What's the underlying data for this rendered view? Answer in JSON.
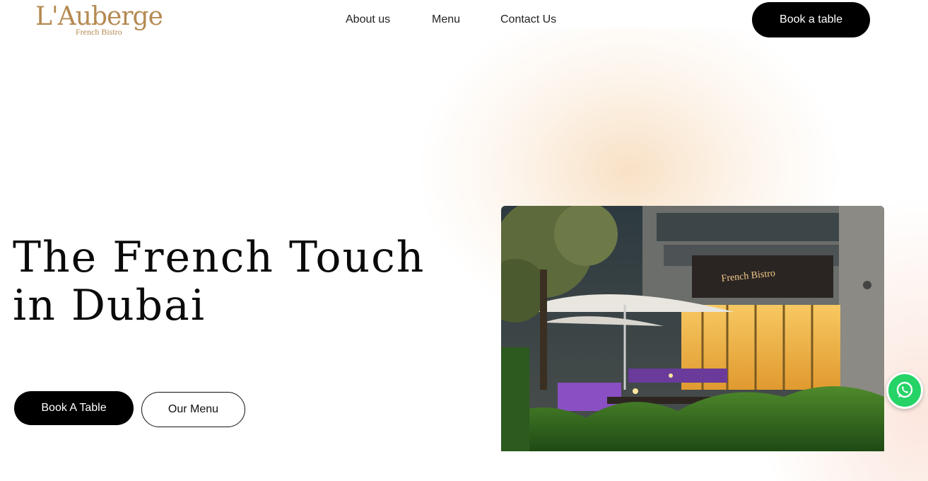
{
  "brand": {
    "name": "L'Auberge",
    "tagline": "French Bistro",
    "color": "#b58a52"
  },
  "nav": {
    "items": [
      {
        "label": "About us"
      },
      {
        "label": "Menu"
      },
      {
        "label": "Contact Us"
      }
    ],
    "cta_label": "Book a table"
  },
  "hero": {
    "title_line1": "The French Touch",
    "title_line2": "in Dubai",
    "primary_button": "Book A Table",
    "secondary_button": "Our Menu",
    "image_sign_text": "French Bistro"
  },
  "floating": {
    "whatsapp_icon": "whatsapp-icon",
    "whatsapp_color": "#25d366"
  }
}
